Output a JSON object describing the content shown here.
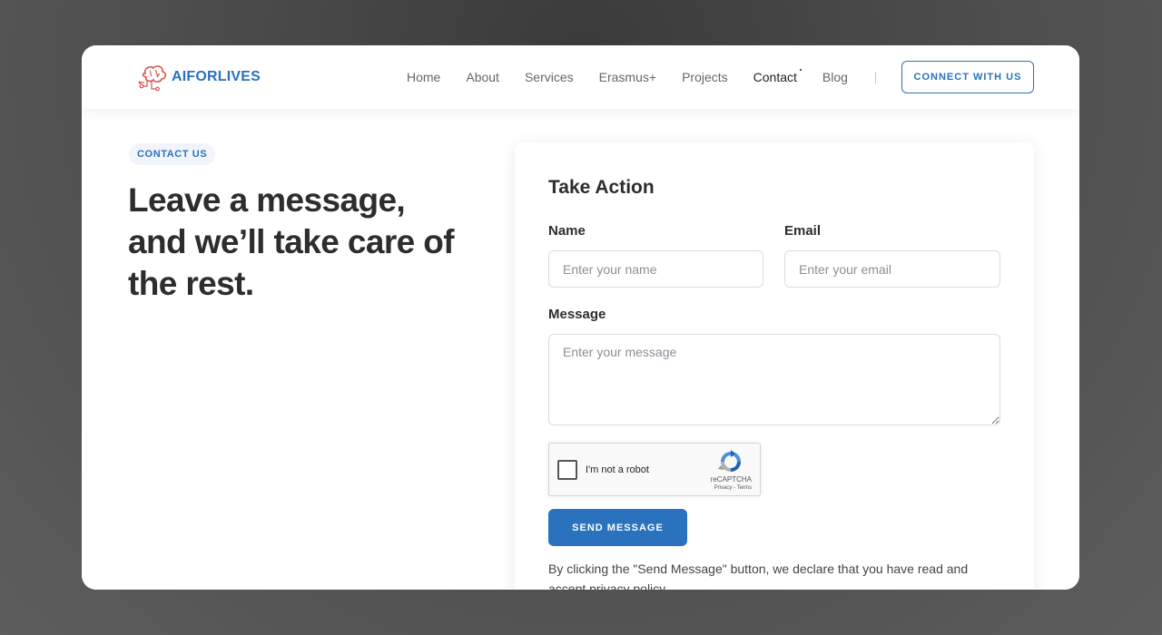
{
  "header": {
    "logo_text": "AIFORLIVES",
    "nav": [
      {
        "label": "Home"
      },
      {
        "label": "About"
      },
      {
        "label": "Services"
      },
      {
        "label": "Erasmus+"
      },
      {
        "label": "Projects"
      },
      {
        "label": "Contact"
      },
      {
        "label": "Blog"
      }
    ],
    "active_nav": "Contact",
    "cta_label": "CONNECT WITH US"
  },
  "hero": {
    "badge": "CONTACT US",
    "title": "Leave a message, and we’ll take care of the rest."
  },
  "form": {
    "title": "Take Action",
    "name_label": "Name",
    "name_placeholder": "Enter your name",
    "name_value": "",
    "email_label": "Email",
    "email_placeholder": "Enter your email",
    "email_value": "",
    "message_label": "Message",
    "message_placeholder": "Enter your message",
    "message_value": "",
    "captcha": {
      "text": "I'm not a robot",
      "brand": "reCAPTCHA",
      "links": "Privacy - Terms",
      "checked": false
    },
    "submit_label": "SEND MESSAGE",
    "disclaimer": "By clicking the \"Send Message\" button, we declare that you have read and accept privacy policy."
  },
  "colors": {
    "accent": "#2a72bd",
    "logo_icon": "#d9534f",
    "heading": "#2d2d2d"
  },
  "icons": {
    "logo": "brain-circuit-icon",
    "captcha": "recaptcha-icon"
  }
}
